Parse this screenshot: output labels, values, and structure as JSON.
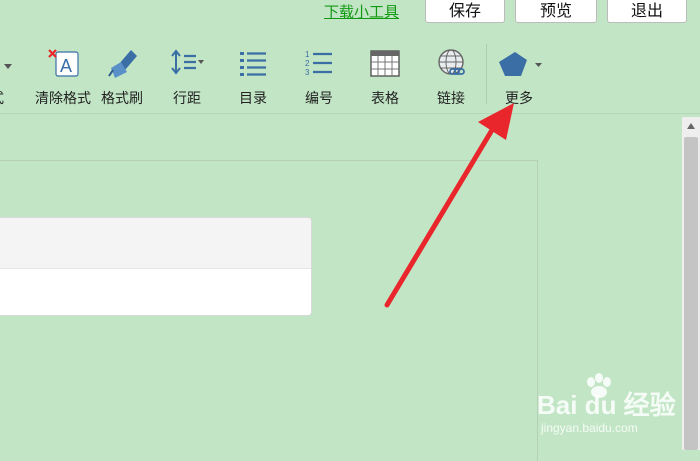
{
  "header": {
    "tool_link": "下载小工具",
    "buttons": {
      "save": "保存",
      "preview": "预览",
      "exit": "退出"
    }
  },
  "toolbar": {
    "partial_label": "式",
    "clear_format": "清除格式",
    "format_painter": "格式刷",
    "line_spacing": "行距",
    "toc": "目录",
    "numbering": "编号",
    "table": "表格",
    "link": "链接",
    "more": "更多"
  },
  "watermark": {
    "brand": "Bai du 经验",
    "url": "jingyan.baidu.com"
  },
  "colors": {
    "background": "#c2e6c5",
    "link_green": "#119911",
    "icon_blue": "#3a6ea5",
    "arrow_red": "#e8262b"
  }
}
